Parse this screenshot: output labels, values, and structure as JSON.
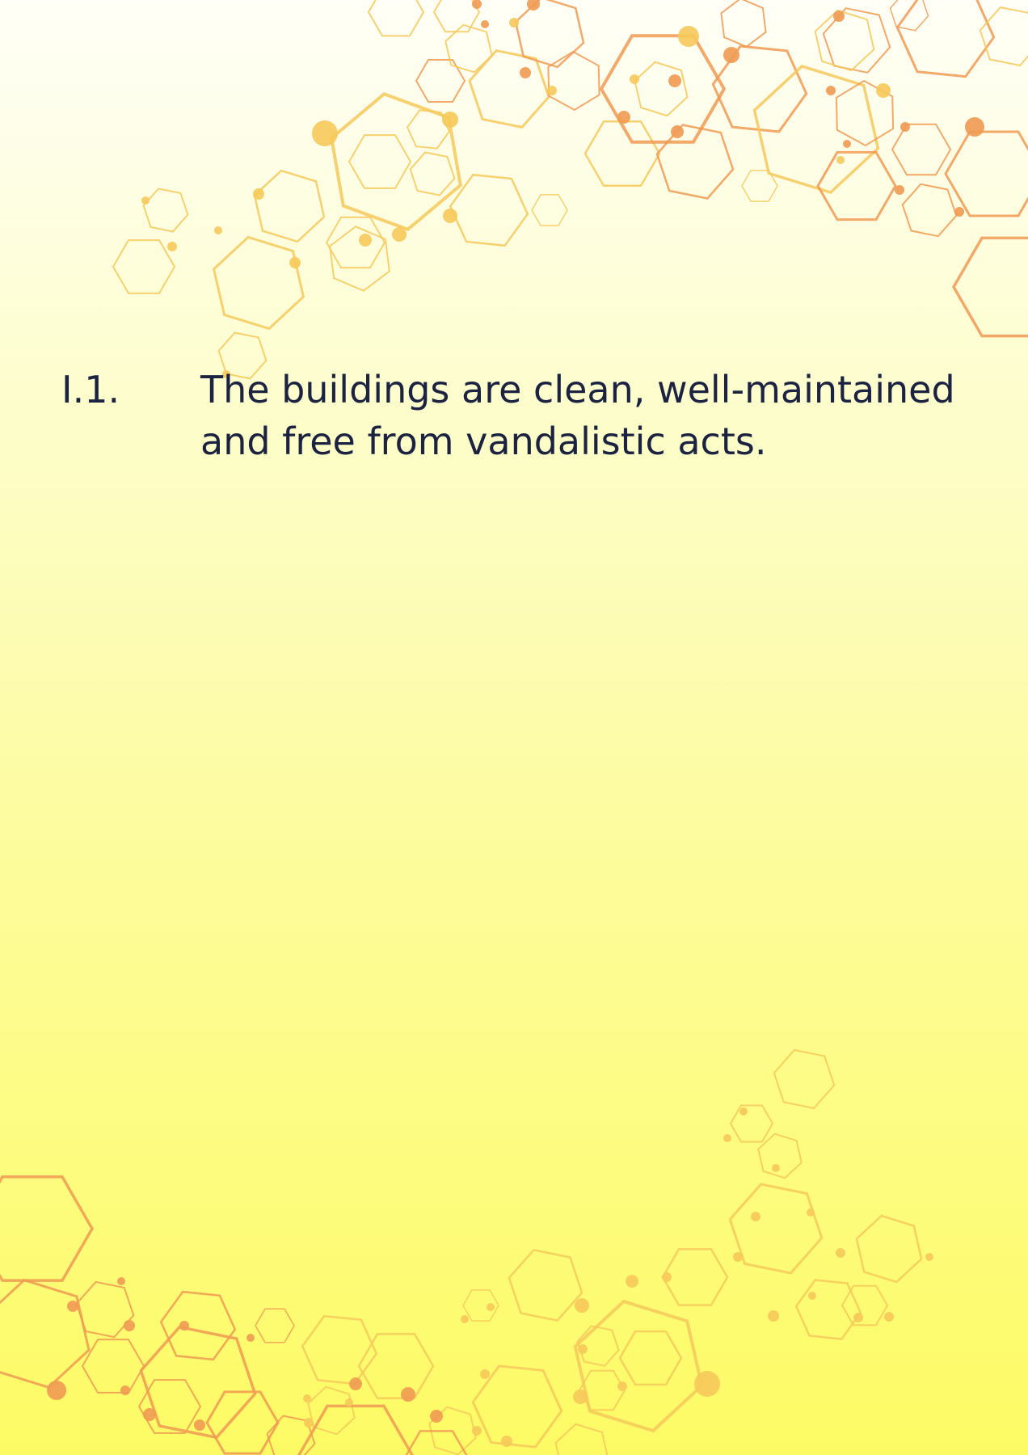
{
  "item": {
    "number": "I.1.",
    "text": "The buildings are clean, well-maintained and free from vandalistic acts."
  },
  "decoration": {
    "icon": "hexagon-pattern-icon",
    "colors": {
      "background_top": "#fffff7",
      "background_bottom": "#fdfb64",
      "hex_yellow": "#f6c95a",
      "hex_orange": "#f09a52",
      "text": "#1b2340"
    }
  }
}
